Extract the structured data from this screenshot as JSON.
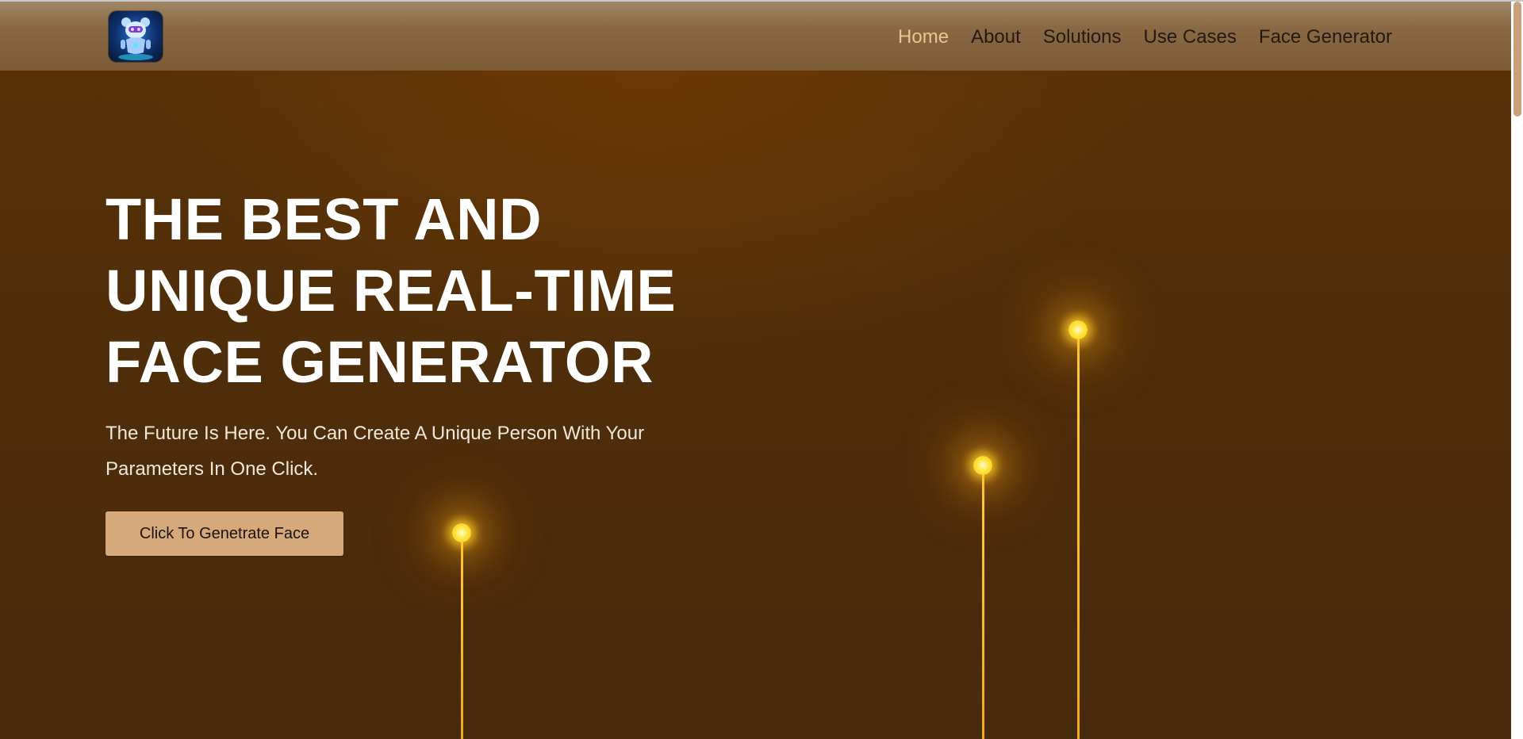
{
  "header": {
    "logo_icon": "robot-logo-icon",
    "nav": [
      {
        "label": "Home",
        "active": true
      },
      {
        "label": "About",
        "active": false
      },
      {
        "label": "Solutions",
        "active": false
      },
      {
        "label": "Use Cases",
        "active": false
      },
      {
        "label": "Face Generator",
        "active": false
      }
    ]
  },
  "hero": {
    "title_lines": [
      "THE BEST AND",
      "UNIQUE REAL-TIME",
      "FACE GENERATOR"
    ],
    "subtitle_lines": [
      "The Future Is Here. You Can Create A Unique Person With Your",
      "Parameters In One Click."
    ],
    "cta_label": "Click To Genetrate Face"
  },
  "colors": {
    "background": "#4f2e0a",
    "header": "#7b5a35",
    "nav_active": "#e8c592",
    "cta": "#d6a97c",
    "glow": "#ffd23a"
  }
}
